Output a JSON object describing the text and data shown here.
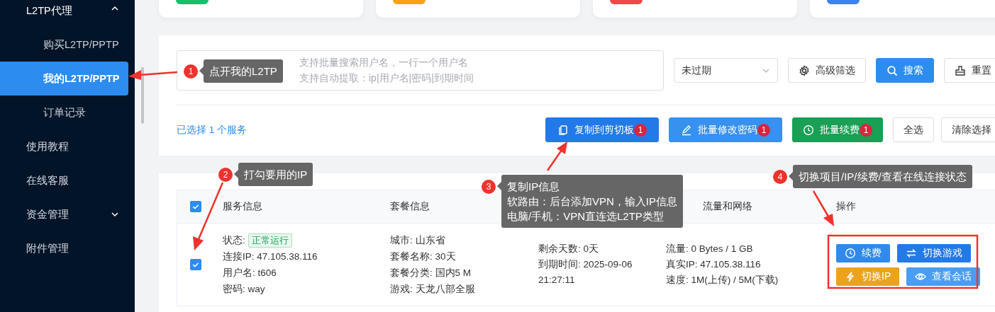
{
  "sidebar": {
    "items": [
      {
        "label": "L2TP代理",
        "selected": false,
        "expanded": true,
        "children": [
          {
            "label": "购买L2TP/PPTP",
            "selected": false
          },
          {
            "label": "我的L2TP/PPTP",
            "selected": true
          },
          {
            "label": "订单记录",
            "selected": false
          }
        ]
      },
      {
        "label": "使用教程",
        "selected": false
      },
      {
        "label": "在线客服",
        "selected": false
      },
      {
        "label": "资金管理",
        "selected": false,
        "expanded": false
      },
      {
        "label": "附件管理",
        "selected": false
      }
    ]
  },
  "stat_cards": [
    {
      "color": "#19be6b"
    },
    {
      "color": "#f7a515"
    },
    {
      "color": "#f04848"
    },
    {
      "color": "#3d82f0"
    }
  ],
  "search": {
    "placeholder": [
      "支持批量搜索用户名，一行一个用户名",
      "支持自动提取：ip|用户名|密码|到期时间"
    ],
    "status_select": "未过期",
    "buttons": [
      {
        "label": "高级筛选",
        "kind": "filter"
      },
      {
        "label": "搜索",
        "kind": "search"
      },
      {
        "label": "重置",
        "kind": "reset"
      }
    ]
  },
  "selection": {
    "text": "已选择 1 个服务",
    "batch_buttons": [
      {
        "label": "复制到剪切板",
        "count": "1",
        "kind": "copy"
      },
      {
        "label": "批量修改密码",
        "count": "1",
        "kind": "password"
      },
      {
        "label": "批量续费",
        "count": "1",
        "kind": "renew"
      }
    ],
    "buttons": [
      "全选",
      "清除选择"
    ]
  },
  "table": {
    "header": {
      "checked": true,
      "service": "服务信息",
      "plan": "套餐信息",
      "column_4": "流量和网络",
      "actions": "操作"
    },
    "rows": [
      {
        "checked": true,
        "status_label": "状态:",
        "status": "正常运行",
        "service": [
          "连接IP: 47.105.38.116",
          "用户名: t606",
          "密码: way"
        ],
        "plan": [
          "城市: 山东省",
          "套餐名称: 30天",
          "套餐分类: 国内5 M",
          "游戏: 天龙八部全服"
        ],
        "time": [
          "剩余天数: 0天",
          "到期时间: 2025-09-06",
          "21:27:11"
        ],
        "network": [
          "流量: 0 Bytes / 1 GB",
          "真实IP: 47.105.38.116",
          "速度: 1M(上传) / 5M(下载)"
        ],
        "actions": [
          {
            "label": "续费",
            "kind": "renew"
          },
          {
            "label": "切换游戏",
            "kind": "switch"
          },
          {
            "label": "切换IP",
            "kind": "ip"
          },
          {
            "label": "查看会话",
            "kind": "view"
          }
        ]
      }
    ]
  },
  "annotations": [
    {
      "number": "1",
      "lines": [
        "点开我的L2TP"
      ]
    },
    {
      "number": "2",
      "lines": [
        "打勾要用的IP"
      ]
    },
    {
      "number": "3",
      "lines": [
        "复制IP信息",
        "软路由：后台添加VPN，输入IP信息",
        "电脑/手机：VPN直连选L2TP类型"
      ]
    },
    {
      "number": "4",
      "lines": [
        "切换项目/IP/续费/查看在线连接状态"
      ]
    }
  ]
}
